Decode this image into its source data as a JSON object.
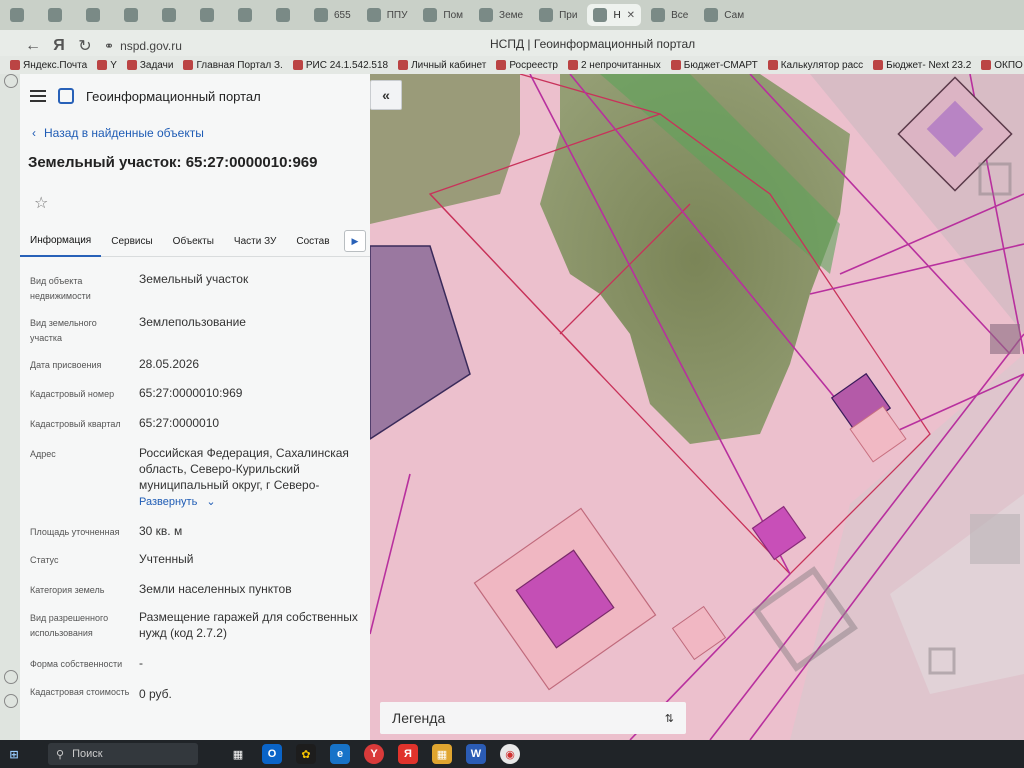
{
  "browser": {
    "tabs": [
      {
        "label": "",
        "active": false
      },
      {
        "label": "",
        "active": false
      },
      {
        "label": "",
        "active": false
      },
      {
        "label": "",
        "active": false
      },
      {
        "label": "",
        "active": false
      },
      {
        "label": "",
        "active": false
      },
      {
        "label": "",
        "active": false
      },
      {
        "label": "",
        "active": false
      },
      {
        "label": "655",
        "active": false
      },
      {
        "label": "ППУ",
        "active": false
      },
      {
        "label": "Пом",
        "active": false
      },
      {
        "label": "Земе",
        "active": false
      },
      {
        "label": "При",
        "active": false
      },
      {
        "label": "Н",
        "active": true
      },
      {
        "label": "Все",
        "active": false
      },
      {
        "label": "Сам",
        "active": false
      }
    ],
    "url": "nspd.gov.ru",
    "page_title": "НСПД | Геоинформационный портал",
    "bookmarks": [
      "Яндекс.Почта",
      "Y",
      "Задачи",
      "Главная Портал З.",
      "РИС 24.1.542.518",
      "Личный кабинет",
      "Росреестр",
      "2 непрочитанных",
      "Бюджет-СМАРТ",
      "Калькулятор расс",
      "Бюджет- Next 23.2",
      "ОКПО по"
    ]
  },
  "app": {
    "name": "Геоинформационный портал",
    "back_label": "Назад в найденные объекты",
    "object_title": "Земельный участок: 65:27:0000010:969",
    "tabs": [
      "Информация",
      "Сервисы",
      "Объекты",
      "Части ЗУ",
      "Состав"
    ],
    "properties": [
      {
        "key": "Вид объекта недвижимости",
        "value": "Земельный участок"
      },
      {
        "key": "Вид земельного участка",
        "value": "Землепользование"
      },
      {
        "key": "Дата присвоения",
        "value": "28.05.2026"
      },
      {
        "key": "Кадастровый номер",
        "value": "65:27:0000010:969"
      },
      {
        "key": "Кадастровый квартал",
        "value": "65:27:0000010"
      },
      {
        "key": "Адрес",
        "value": "Российская Федерация, Сахалинская область, Северо-Курильский муниципальный округ, г Северо-"
      },
      {
        "key": "Площадь уточненная",
        "value": "30 кв. м"
      },
      {
        "key": "Статус",
        "value": "Учтенный"
      },
      {
        "key": "Категория земель",
        "value": "Земли населенных пунктов"
      },
      {
        "key": "Вид разрешенного использования",
        "value": "Размещение гаражей для собственных нужд (код 2.7.2)"
      },
      {
        "key": "Форма собственности",
        "value": "-"
      },
      {
        "key": "Кадастровая стоимость",
        "value": "0 руб."
      }
    ],
    "expand_label": "Развернуть",
    "legend_label": "Легенда"
  },
  "taskbar": {
    "search_placeholder": "Поиск"
  },
  "colors": {
    "accent": "#2861b8",
    "map_pink": "#ecc0cd",
    "parcel_magenta": "#c23fa8",
    "forest_green": "#7e8a55"
  }
}
